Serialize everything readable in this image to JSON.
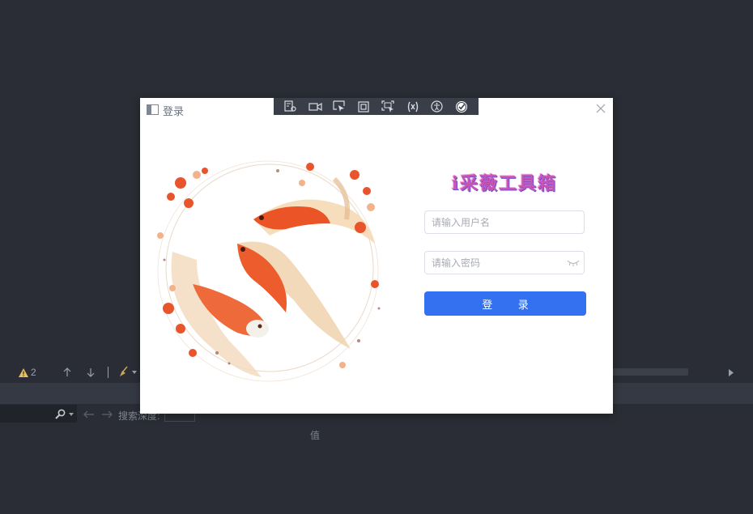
{
  "dialog": {
    "title": "登录",
    "brand": "i采薇工具箱",
    "username_placeholder": "请输入用户名",
    "password_placeholder": "请输入密码",
    "login_label": "登 录",
    "accent_color": "#3471f0"
  },
  "devtools": {
    "icons": [
      "settings-icon",
      "video-icon",
      "select-pointer-icon",
      "frame-icon",
      "screenshot-icon",
      "layout-icon",
      "accessibility-icon",
      "check-circle-icon"
    ]
  },
  "background": {
    "warning_count": "2",
    "search_label": "搜索深度:",
    "value_column": "值"
  }
}
